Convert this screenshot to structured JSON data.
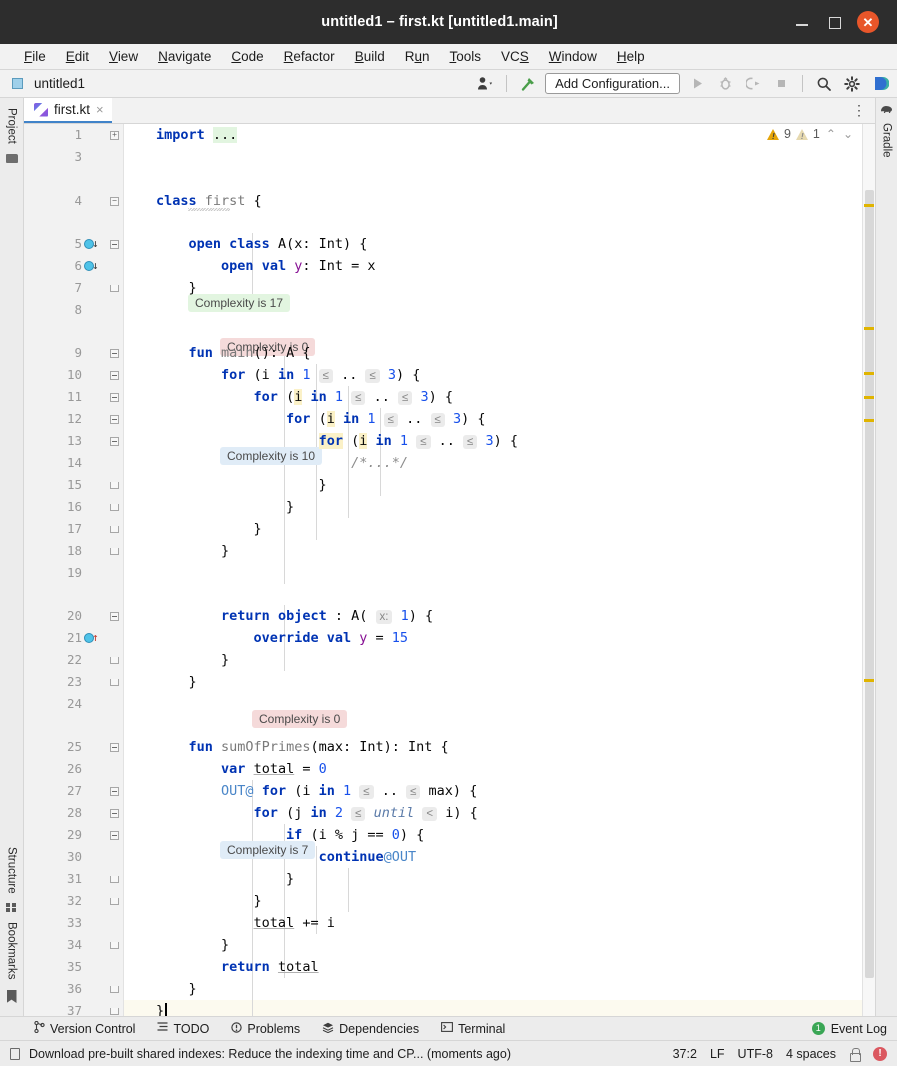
{
  "window": {
    "title": "untitled1 – first.kt [untitled1.main]",
    "minimize_label": "–",
    "maximize_label": "□",
    "close_label": "✕"
  },
  "menubar": [
    {
      "label": "File",
      "mnemonic": "F"
    },
    {
      "label": "Edit",
      "mnemonic": "E"
    },
    {
      "label": "View",
      "mnemonic": "V"
    },
    {
      "label": "Navigate",
      "mnemonic": "N"
    },
    {
      "label": "Code",
      "mnemonic": "C"
    },
    {
      "label": "Refactor",
      "mnemonic": "R"
    },
    {
      "label": "Build",
      "mnemonic": "B"
    },
    {
      "label": "Run",
      "mnemonic": "u"
    },
    {
      "label": "Tools",
      "mnemonic": "T"
    },
    {
      "label": "VCS",
      "mnemonic": "S"
    },
    {
      "label": "Window",
      "mnemonic": "W"
    },
    {
      "label": "Help",
      "mnemonic": "H"
    }
  ],
  "navbar": {
    "breadcrumb": "untitled1",
    "run_configuration": "Add Configuration...",
    "icons": [
      "user-avatar-dropdown-icon",
      "build-hammer-icon",
      "run-icon",
      "debug-icon",
      "run-coverage-icon",
      "stop-icon",
      "search-everywhere-icon",
      "settings-gear-icon",
      "ide-assistant-icon"
    ]
  },
  "left_rail": {
    "top": [
      "Project"
    ],
    "bottom": [
      "Structure",
      "Bookmarks"
    ]
  },
  "right_rail": {
    "label": "Gradle"
  },
  "tabs": [
    {
      "label": "first.kt",
      "icon": "kotlin-file-icon",
      "close": "×",
      "active": true
    }
  ],
  "inspections": {
    "warnings": "9",
    "weak_warnings": "1",
    "prev_label": "⌃",
    "next_label": "⌄",
    "warning_glyph": "!",
    "weak_glyph": "!"
  },
  "editor": {
    "complexity_badges": [
      {
        "text": "Complexity is 17",
        "tone": "green"
      },
      {
        "text": "Complexity is 0",
        "tone": "pink"
      },
      {
        "text": "Complexity is 10",
        "tone": "blue"
      },
      {
        "text": "Complexity is 0",
        "tone": "pink"
      },
      {
        "text": "Complexity is 7",
        "tone": "blue"
      }
    ],
    "line_numbers": [
      "1",
      "3",
      "4",
      "5",
      "6",
      "7",
      "8",
      "9",
      "10",
      "11",
      "12",
      "13",
      "14",
      "15",
      "16",
      "17",
      "18",
      "19",
      "20",
      "21",
      "22",
      "23",
      "24",
      "25",
      "26",
      "27",
      "28",
      "29",
      "30",
      "31",
      "32",
      "33",
      "34",
      "35",
      "36",
      "37"
    ],
    "code_lines": [
      {
        "n": "1",
        "text": "import ..."
      },
      {
        "n": "3",
        "text": ""
      },
      {
        "n": "4",
        "text": "class first {"
      },
      {
        "n": "5",
        "text": "    open class A(x: Int) {"
      },
      {
        "n": "6",
        "text": "        open val y: Int = x"
      },
      {
        "n": "7",
        "text": "    }"
      },
      {
        "n": "8",
        "text": ""
      },
      {
        "n": "9",
        "text": "    fun main(): A {"
      },
      {
        "n": "10",
        "text": "        for (i in 1 ≤ .. ≤ 3) {"
      },
      {
        "n": "11",
        "text": "            for (i in 1 ≤ .. ≤ 3) {"
      },
      {
        "n": "12",
        "text": "                for (i in 1 ≤ .. ≤ 3) {"
      },
      {
        "n": "13",
        "text": "                    for (i in 1 ≤ .. ≤ 3) {"
      },
      {
        "n": "14",
        "text": "                        /*...*/"
      },
      {
        "n": "15",
        "text": "                    }"
      },
      {
        "n": "16",
        "text": "                }"
      },
      {
        "n": "17",
        "text": "            }"
      },
      {
        "n": "18",
        "text": "        }"
      },
      {
        "n": "19",
        "text": ""
      },
      {
        "n": "20",
        "text": "        return object : A( x: 1) {"
      },
      {
        "n": "21",
        "text": "            override val y = 15"
      },
      {
        "n": "22",
        "text": "        }"
      },
      {
        "n": "23",
        "text": "    }"
      },
      {
        "n": "24",
        "text": ""
      },
      {
        "n": "25",
        "text": "    fun sumOfPrimes(max: Int): Int {"
      },
      {
        "n": "26",
        "text": "        var total = 0"
      },
      {
        "n": "27",
        "text": "        OUT@ for (i in 1 ≤ .. ≤ max) {"
      },
      {
        "n": "28",
        "text": "            for (j in 2 ≤ until < i) {"
      },
      {
        "n": "29",
        "text": "                if (i % j == 0) {"
      },
      {
        "n": "30",
        "text": "                    continue@OUT"
      },
      {
        "n": "31",
        "text": "                }"
      },
      {
        "n": "32",
        "text": "            }"
      },
      {
        "n": "33",
        "text": "            total += i"
      },
      {
        "n": "34",
        "text": "        }"
      },
      {
        "n": "35",
        "text": "        return total"
      },
      {
        "n": "36",
        "text": "    }"
      },
      {
        "n": "37",
        "text": "}"
      }
    ],
    "tokens": {
      "import": "import",
      "ellipsis": "...",
      "class": "class",
      "first": "first",
      "open": "open",
      "A": "A",
      "x_param": "x",
      "Int": "Int",
      "val": "val",
      "y": "y",
      "fun": "fun",
      "main": "main",
      "for": "for",
      "in": "in",
      "comment": "/*...*/",
      "return": "return",
      "object": "object",
      "override": "override",
      "fifteen": "15",
      "sumOfPrimes": "sumOfPrimes",
      "max": "max",
      "var": "var",
      "total": "total",
      "zero": "0",
      "OUT_label": "OUT@",
      "j": "j",
      "two": "2",
      "until": "until",
      "if": "if",
      "continue": "continue@OUT",
      "one": "1",
      "three": "3",
      "le": "≤",
      "lt": "<",
      "xhint": "x:"
    }
  },
  "toolwindow_bar": {
    "items": [
      {
        "label": "Version Control",
        "icon": "branch-icon"
      },
      {
        "label": "TODO",
        "icon": "list-icon"
      },
      {
        "label": "Problems",
        "icon": "problems-icon"
      },
      {
        "label": "Dependencies",
        "icon": "layers-icon"
      },
      {
        "label": "Terminal",
        "icon": "terminal-icon"
      }
    ],
    "event_log": {
      "label": "Event Log",
      "badge": "1"
    }
  },
  "statusbar": {
    "message": "Download pre-built shared indexes: Reduce the indexing time and CP... (moments ago)",
    "caret_position": "37:2",
    "line_separator": "LF",
    "encoding": "UTF-8",
    "indent": "4 spaces",
    "lock_icon": "read-only-lock-icon",
    "error_icon": "error-badge-icon",
    "error_glyph": "!"
  },
  "colors": {
    "titlebar_bg": "#2d2d2d",
    "close_button": "#e8562a",
    "tab_underline": "#4083c9",
    "keyword": "#0033b3",
    "number": "#1750eb",
    "property": "#871094",
    "comment": "#8c8c8c",
    "label": "#4a86c8",
    "inlay_bg": "#ebebeb",
    "complexity_green": "#e2f5e0",
    "complexity_pink": "#f5dada",
    "complexity_blue": "#e0ecf7",
    "warning_stripe": "#e0b400",
    "caret_line": "#fcfaef",
    "occurrence_highlight": "#fbf1c7"
  }
}
